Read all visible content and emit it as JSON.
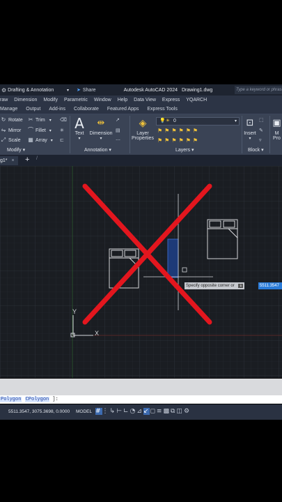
{
  "titlebar": {
    "workspace": "Drafting & Annotation",
    "share": "Share",
    "title": "Autodesk AutoCAD 2024",
    "filename": "Drawing1.dwg",
    "search_placeholder": "Type a keyword or phrase"
  },
  "menubar": [
    "raw",
    "Dimension",
    "Modify",
    "Parametric",
    "Window",
    "Help",
    "Data View",
    "Express",
    "YQARCH"
  ],
  "ribbon_tabs": [
    "Manage",
    "Output",
    "Add-ins",
    "Collaborate",
    "Featured Apps",
    "Express Tools"
  ],
  "ribbon": {
    "modify": {
      "rotate": "Rotate",
      "trim": "Trim",
      "mirror": "Mirror",
      "fillet": "Fillet",
      "scale": "Scale",
      "array": "Array",
      "title": "Modify"
    },
    "annotation": {
      "text": "Text",
      "dimension": "Dimension",
      "title": "Annotation"
    },
    "layers": {
      "layer_properties_1": "Layer",
      "layer_properties_2": "Properties",
      "current_layer": "0",
      "title": "Layers"
    },
    "block": {
      "insert": "Insert",
      "title": "Block",
      "cut_m": "M",
      "cut_pro": "Pro"
    }
  },
  "doc_tab": {
    "label": "g1*",
    "close": "×",
    "new": "+"
  },
  "canvas": {
    "prompt": "Specify opposite corner or",
    "prompt_arrow": "⇣",
    "coord_input": "5511.3547",
    "ucs_x": "X",
    "ucs_y": "Y"
  },
  "command_line": {
    "prefix": "Polygon",
    "kw2": "CPolygon",
    "suffix": "]:"
  },
  "statusbar": {
    "coords": "5511.3547, 3075.3698, 0.0000",
    "model": "MODEL"
  },
  "colors": {
    "accent": "#2a7bd8",
    "cross": "#e3161e",
    "canvas_bg": "#1a1d22"
  }
}
